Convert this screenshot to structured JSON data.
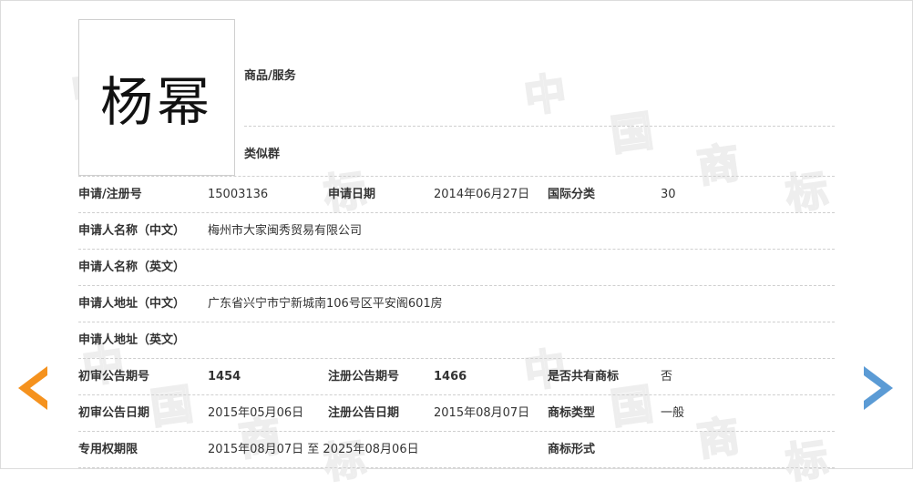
{
  "trademark": {
    "name": "杨幂"
  },
  "header": {
    "goods_label": "商品/服务",
    "similar_label": "类似群"
  },
  "rows": [
    {
      "cells": [
        {
          "label": "申请/注册号",
          "value": "15003136"
        },
        {
          "label": "申请日期",
          "value": "2014年06月27日"
        },
        {
          "label": "国际分类",
          "value": "30"
        }
      ]
    },
    {
      "cells": [
        {
          "label": "申请人名称（中文）",
          "value": "梅州市大家闽秀贸易有限公司"
        }
      ]
    },
    {
      "cells": [
        {
          "label": "申请人名称（英文）",
          "value": ""
        }
      ]
    },
    {
      "cells": [
        {
          "label": "申请人地址（中文）",
          "value": "广东省兴宁市宁新城南106号区平安阁601房"
        }
      ]
    },
    {
      "cells": [
        {
          "label": "申请人地址（英文）",
          "value": ""
        }
      ]
    },
    {
      "cells": [
        {
          "label": "初审公告期号",
          "value": "1454"
        },
        {
          "label": "注册公告期号",
          "value": "1466"
        },
        {
          "label": "是否共有商标",
          "value": "否"
        }
      ]
    },
    {
      "cells": [
        {
          "label": "初审公告日期",
          "value": "2015年05月06日"
        },
        {
          "label": "注册公告日期",
          "value": "2015年08月07日"
        },
        {
          "label": "商标类型",
          "value": "一般"
        }
      ]
    },
    {
      "cells": [
        {
          "label": "专用权期限",
          "value": "2015年08月07日 至 2025年08月06日"
        },
        {
          "label": "商标形式",
          "value": ""
        }
      ]
    }
  ],
  "watermark": {
    "chars": [
      "中",
      "国",
      "商",
      "标"
    ]
  },
  "nav": {
    "prev_icon": "arrow-left-icon",
    "next_icon": "arrow-right-icon"
  },
  "colors": {
    "prev_arrow": "#f5921e",
    "next_arrow": "#5b9bd5",
    "divider": "#cfcfcf"
  }
}
